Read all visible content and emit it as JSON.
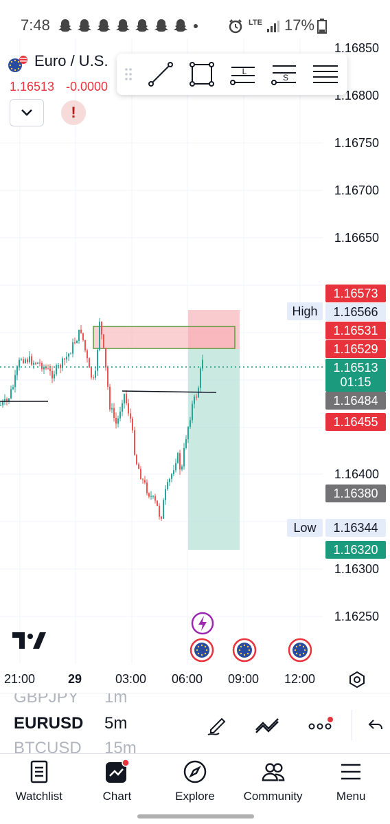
{
  "status_bar": {
    "time": "7:48",
    "network": "LTE",
    "battery": "17%"
  },
  "symbol": {
    "name": "Euro / U.S.",
    "price": "1.16513",
    "change": "-0.0000"
  },
  "colors": {
    "up": "#26a69a",
    "down": "#ef5350",
    "accent_red": "#e8323c",
    "accent_green": "#1b9a7d",
    "gray_tag": "#737375"
  },
  "toolbar": {
    "tools": [
      "trend-line-icon",
      "rectangle-icon",
      "long-position-icon",
      "short-position-icon",
      "horizontal-lines-icon"
    ],
    "long_letter": "L",
    "short_letter": "S"
  },
  "price_axis": {
    "labels": [
      "1.16850",
      "1.16800",
      "1.16750",
      "1.16700",
      "1.16650",
      "1.16400",
      "1.16300",
      "1.16250"
    ]
  },
  "price_tags": {
    "t1": "1.16573",
    "high_label": "High",
    "high": "1.16566",
    "t3": "1.16531",
    "t4": "1.16529",
    "current": "1.16513",
    "countdown": "01:15",
    "t6": "1.16484",
    "t7": "1.16455",
    "t8": "1.16380",
    "low_label": "Low",
    "low": "1.16344",
    "t10": "1.16320"
  },
  "time_axis": {
    "labels": [
      "21:00",
      "29",
      "03:00",
      "06:00",
      "09:00",
      "12:00"
    ]
  },
  "selector": {
    "prev_symbol": "GBPJPY",
    "prev_tf": "1m",
    "symbol": "EURUSD",
    "tf": "5m",
    "next_symbol": "BTCUSD",
    "next_tf": "15m"
  },
  "nav": {
    "watchlist": "Watchlist",
    "chart": "Chart",
    "explore": "Explore",
    "community": "Community",
    "menu": "Menu"
  }
}
